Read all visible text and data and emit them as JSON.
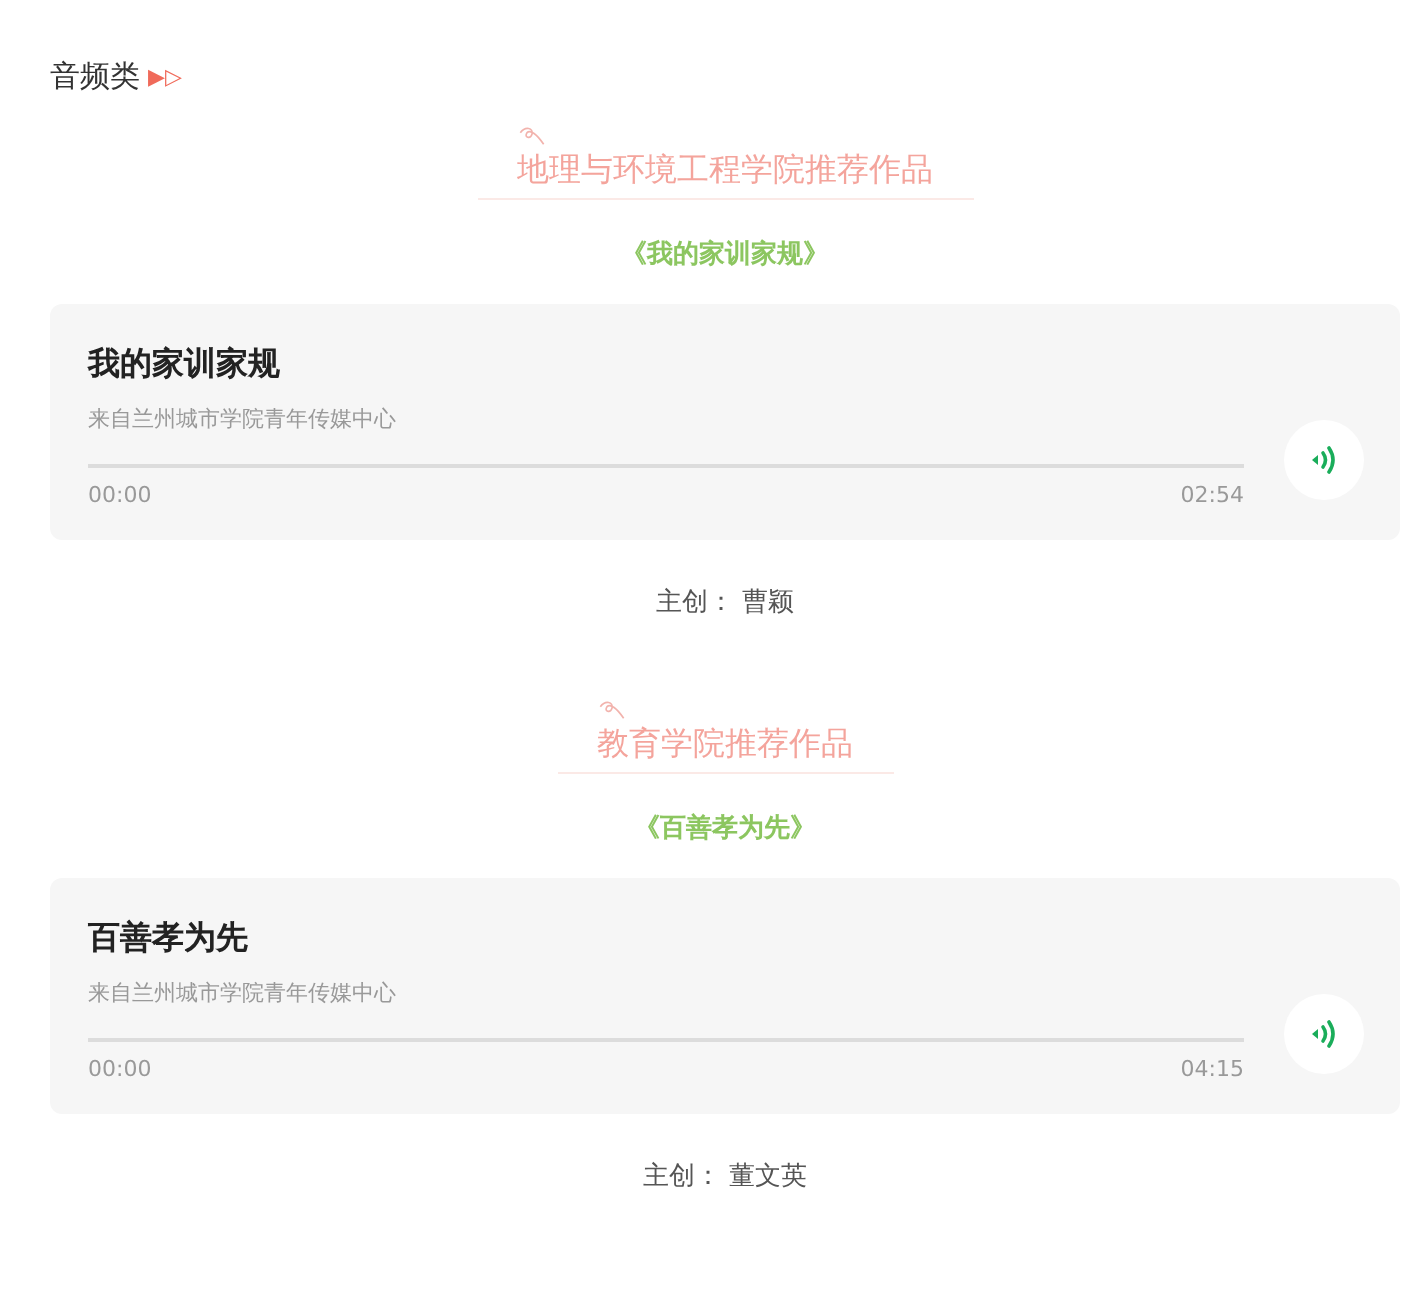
{
  "category": {
    "label": "音频类",
    "marker": "▶▷"
  },
  "sections": [
    {
      "heading": "地理与环境工程学院推荐作品",
      "work_title": "《我的家训家规》",
      "audio": {
        "title": "我的家训家规",
        "source": "来自兰州城市学院青年传媒中心",
        "elapsed": "00:00",
        "duration": "02:54",
        "level": 0
      },
      "credit": "主创： 曹颖"
    },
    {
      "heading": "教育学院推荐作品",
      "work_title": "《百善孝为先》",
      "audio": {
        "title": "百善孝为先",
        "source": "来自兰州城市学院青年传媒中心",
        "elapsed": "00:00",
        "duration": "04:15",
        "level": 0
      },
      "credit": "主创： 董文英"
    }
  ]
}
